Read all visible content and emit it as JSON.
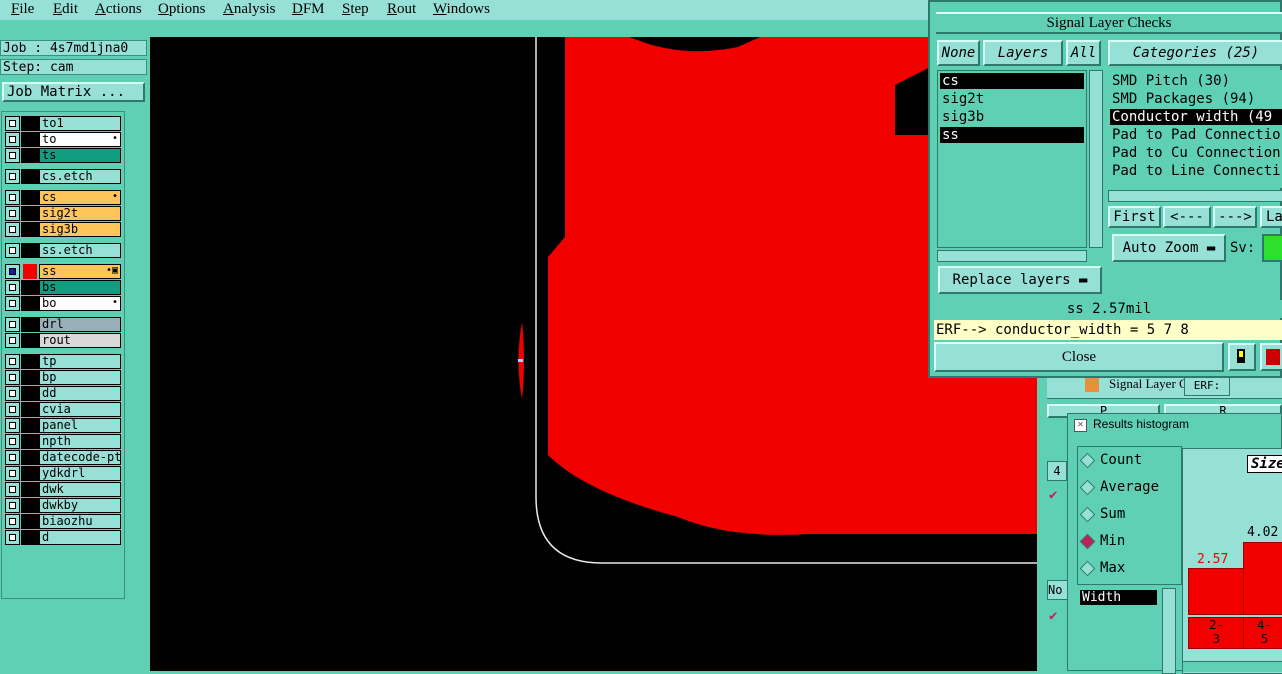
{
  "menubar": {
    "items": [
      "File",
      "Edit",
      "Actions",
      "Options",
      "Analysis",
      "DFM",
      "Step",
      "Rout",
      "Windows"
    ]
  },
  "job": {
    "job_label": "Job : 4s7md1jna0",
    "step_label": "Step: cam",
    "matrix_button": "Job Matrix ..."
  },
  "layers": [
    {
      "name": "to1",
      "color": "#97e0d6"
    },
    {
      "name": "to",
      "color": "#ffffff",
      "mark": "•"
    },
    {
      "name": "ts",
      "color": "#119e80"
    },
    {
      "name": "cs.etch",
      "color": "#97e0d6"
    },
    {
      "name": "cs",
      "color": "#ffc55a",
      "mark": "•"
    },
    {
      "name": "sig2t",
      "color": "#ffc55a"
    },
    {
      "name": "sig3b",
      "color": "#ffc55a"
    },
    {
      "name": "ss.etch",
      "color": "#97e0d6"
    },
    {
      "name": "ss",
      "color": "#ffc55a",
      "mark": "•▣",
      "active": true
    },
    {
      "name": "bs",
      "color": "#119e80"
    },
    {
      "name": "bo",
      "color": "#ffffff",
      "mark": "•"
    },
    {
      "name": "drl",
      "color": "#9ab0b8"
    },
    {
      "name": "rout",
      "color": "#d8d8d8"
    },
    {
      "name": "tp",
      "color": "#97e0d6"
    },
    {
      "name": "bp",
      "color": "#97e0d6"
    },
    {
      "name": "dd",
      "color": "#97e0d6"
    },
    {
      "name": "cvia",
      "color": "#97e0d6"
    },
    {
      "name": "panel",
      "color": "#97e0d6"
    },
    {
      "name": "npth",
      "color": "#97e0d6"
    },
    {
      "name": "datecode-ptc",
      "color": "#97e0d6"
    },
    {
      "name": "ydkdrl",
      "color": "#97e0d6"
    },
    {
      "name": "dwk",
      "color": "#97e0d6"
    },
    {
      "name": "dwkby",
      "color": "#97e0d6"
    },
    {
      "name": "biaozhu",
      "color": "#97e0d6"
    },
    {
      "name": "d",
      "color": "#97e0d6"
    }
  ],
  "slc": {
    "title": "Signal Layer Checks",
    "none_btn": "None",
    "layers_btn": "Layers",
    "all_btn": "All",
    "layer_items": [
      "cs",
      "sig2t",
      "sig3b",
      "ss"
    ],
    "categories_btn": "Categories (25)",
    "categories": [
      "SMD Pitch (30)",
      "SMD Packages (94)",
      "Conductor width (49",
      "Pad to Pad Connectio",
      "Pad to Cu Connection",
      "Pad to Line Connecti"
    ],
    "first_btn": "First",
    "prev_btn": "<---",
    "next_btn": "--->",
    "last_btn": "La",
    "autozoom_btn": "Auto Zoom",
    "sv_label": "Sv:",
    "replace_btn": "Replace layers",
    "status": "ss 2.57mil",
    "erf": "ERF--> conductor_width = 5 7 8",
    "close_btn": "Close"
  },
  "under": {
    "title": "Signal Layer Ch",
    "erf_label": "ERF:",
    "tab_left": "P",
    "tab_right": "R",
    "field_4": "4",
    "field_no": "No"
  },
  "hist": {
    "title": "Results histogram",
    "options": [
      {
        "label": "Count",
        "on": false
      },
      {
        "label": "Average",
        "on": false
      },
      {
        "label": "Sum",
        "on": false
      },
      {
        "label": "Min",
        "on": true
      },
      {
        "label": "Max",
        "on": false
      }
    ],
    "width_field": "Width",
    "size_label": "Size",
    "bars": [
      {
        "value": "2.57",
        "range_top": "2-",
        "range_bottom": "3"
      },
      {
        "value": "4.02",
        "range_top": "4-",
        "range_bottom": "5"
      }
    ]
  },
  "colors": {
    "copper": "#f20000",
    "panel": "#5fd0b4",
    "widget": "#97e0d6",
    "canvas": "#000000"
  }
}
